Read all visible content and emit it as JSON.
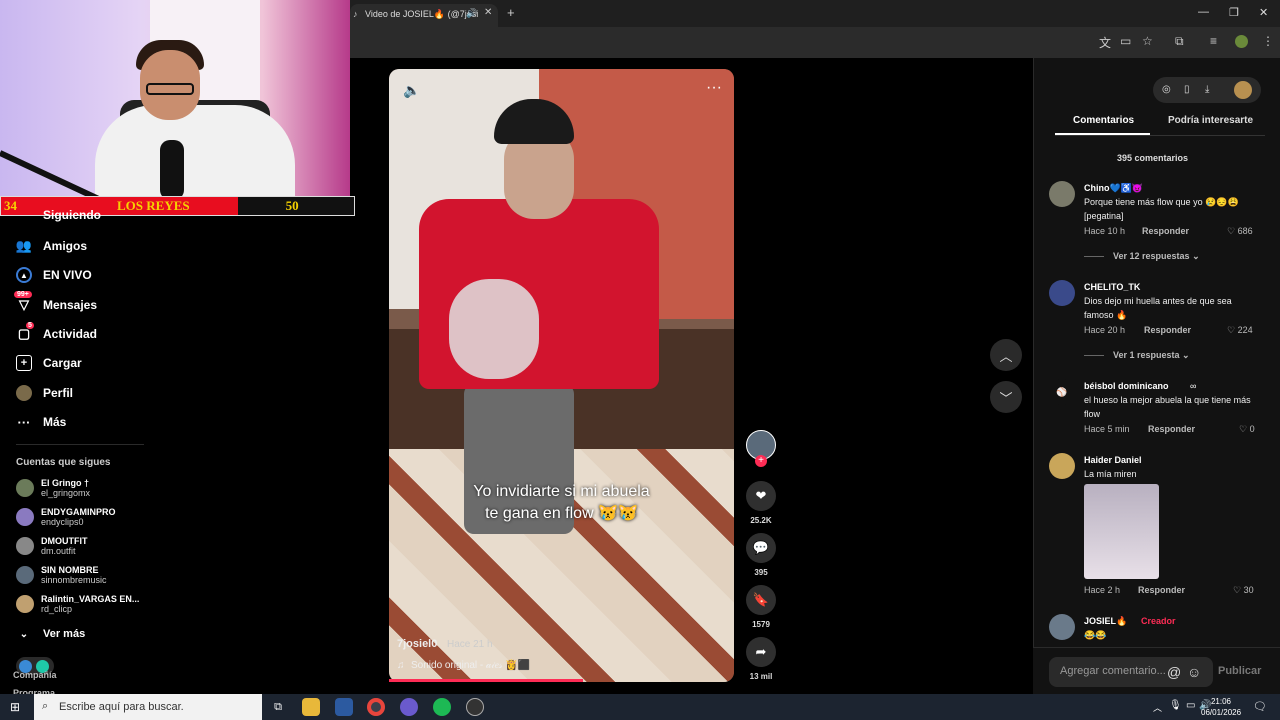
{
  "browser": {
    "tab_title": "Video de JOSIEL🔥 (@7josi",
    "new_tab_symbol": "+",
    "window_controls": {
      "minimize": "—",
      "restore": "❐",
      "close": "✕"
    }
  },
  "overlay": {
    "score_left": "34",
    "team_name": "LOS REYES",
    "score_right": "50",
    "score_colors": {
      "bar": "#e80d1f",
      "text": "#f5d100"
    }
  },
  "sidebar": {
    "partial_item": "Siguiendo",
    "items": [
      {
        "label": "Amigos",
        "icon": "friends-icon"
      },
      {
        "label": "EN VIVO",
        "icon": "live-icon"
      },
      {
        "label": "Mensajes",
        "icon": "messages-icon",
        "badge": "99+"
      },
      {
        "label": "Actividad",
        "icon": "activity-icon",
        "badge": "5"
      },
      {
        "label": "Cargar",
        "icon": "upload-icon"
      },
      {
        "label": "Perfil",
        "icon": "profile-icon"
      },
      {
        "label": "Más",
        "icon": "more-icon"
      }
    ],
    "following_heading": "Cuentas que sigues",
    "accounts": [
      {
        "name": "El Gringo †",
        "handle": "el_gringomx"
      },
      {
        "name": "ENDYGAMINPRO",
        "handle": "endyclips0"
      },
      {
        "name": "DMOUTFIT",
        "handle": "dm.outfit"
      },
      {
        "name": "SIN NOMBRE",
        "handle": "sinnombremusic"
      },
      {
        "name": "Ralintin_VARGAS EN...",
        "handle": "rd_clicp"
      }
    ],
    "see_more": "Ver más",
    "footer_company": "Compañía",
    "footer_program": "Programa"
  },
  "video": {
    "caption_line1": "Yo invidiarte si mi abuela",
    "caption_line2": "te gana en flow 😿😿",
    "author": "7josiel0",
    "time": "Hace 21 h",
    "sound": "Sonido original - 𝒶𝒾𝑒𝓈 👸⬛",
    "progress_percent": 56,
    "accent": "#fe2c55"
  },
  "actions": {
    "likes": "25.2K",
    "comments": "395",
    "saves": "1579",
    "shares": "13 mil"
  },
  "panel": {
    "tab_comments": "Comentarios",
    "tab_interest": "Podría interesarte",
    "count_label": "395 comentarios",
    "comments": [
      {
        "user": "Chino💙♿😈",
        "text": "Porque tiene más flow que yo 😢😔😩 [pegatina]",
        "time": "Hace 10 h",
        "reply": "Responder",
        "likes": "686",
        "replies": "Ver 12 respuestas"
      },
      {
        "user": "CHELITO_TK",
        "text": "Dios dejo mi huella antes de que sea famoso 🔥",
        "time": "Hace 20 h",
        "reply": "Responder",
        "likes": "224",
        "replies": "Ver 1 respuesta"
      },
      {
        "user": "béisbol dominicano",
        "user_suffix": "∞",
        "text": "el hueso la mejor abuela la que tiene más flow",
        "time": "Hace 5 min",
        "reply": "Responder",
        "likes": "0"
      },
      {
        "user": "Haider Daniel",
        "text": "La mía miren",
        "time": "Hace 2 h",
        "reply": "Responder",
        "likes": "30"
      },
      {
        "user": "JOSIEL🔥",
        "creator": "Creador",
        "text": "😂😂"
      }
    ],
    "input_placeholder": "Agregar comentario...",
    "post_button": "Publicar"
  },
  "taskbar": {
    "search_placeholder": "Escribe aquí para buscar.",
    "time": "21:06",
    "date": "06/01/2026"
  }
}
